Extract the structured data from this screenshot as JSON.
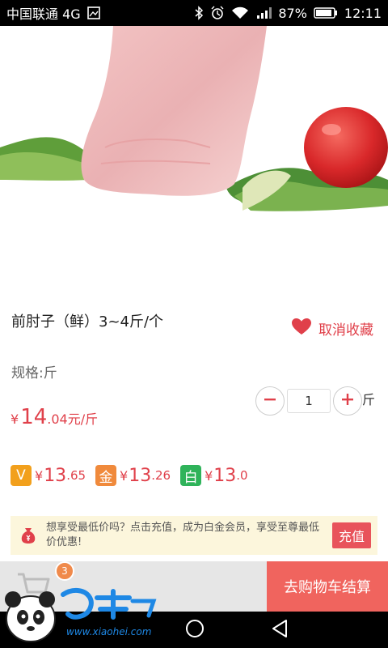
{
  "status_bar": {
    "carrier": "中国联通 4G",
    "battery": "87%",
    "time": "12:11"
  },
  "product": {
    "title": "前肘子（鲜）3~4斤/个",
    "favorite_label": "取消收藏",
    "spec": "规格:斤",
    "quantity": "1",
    "unit": "斤",
    "price": {
      "currency": "¥",
      "integer": "14",
      "decimal": ".04元/斤"
    }
  },
  "member_prices": [
    {
      "badge": "V",
      "badge_color": "#f2a01c",
      "currency": "¥",
      "integer": "13",
      "decimal": ".65"
    },
    {
      "badge": "金",
      "badge_color": "#f08a3c",
      "currency": "¥",
      "integer": "13",
      "decimal": ".26"
    },
    {
      "badge": "白",
      "badge_color": "#2fb35a",
      "currency": "¥",
      "integer": "13",
      "decimal": ".0"
    }
  ],
  "promo": {
    "text": "想享受最低价吗？点击充值，成为白金会员，享受至尊最低价优惠!",
    "button": "充值"
  },
  "cart": {
    "badge_count": "3",
    "checkout_label": "去购物车结算"
  },
  "watermark": {
    "text": "小黑游戏",
    "url": "www.xiaohei.com"
  },
  "colors": {
    "accent": "#e0404a",
    "checkout": "#f0645e",
    "promo_bg": "#fcf6dc"
  }
}
